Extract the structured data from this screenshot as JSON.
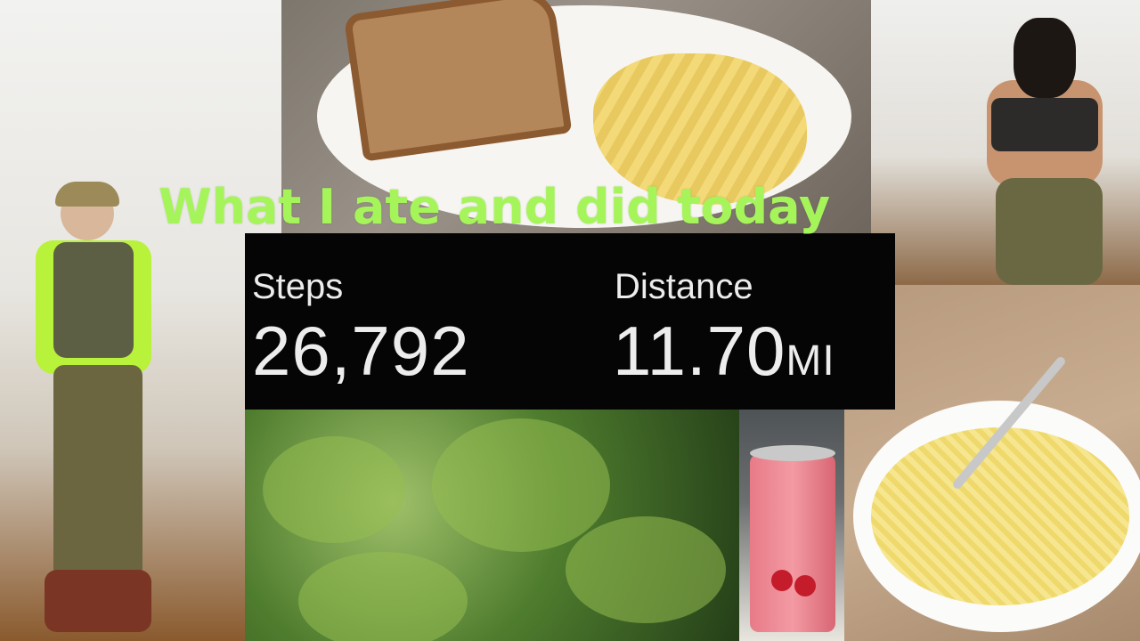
{
  "title": "What I ate and did today",
  "stats": {
    "steps_label": "Steps",
    "steps_value": "26,792",
    "distance_label": "Distance",
    "distance_value": "11.70",
    "distance_unit": "MI"
  },
  "colors": {
    "title": "#a5f55a",
    "stats_background": "#050505",
    "stats_text": "#ededed"
  },
  "photos": [
    "mirror-selfie-photo",
    "sandwich-and-chips-photo",
    "flexing-selfie-photo",
    "tree-canopy-photo",
    "drink-can-photo",
    "pasta-bowl-photo"
  ]
}
